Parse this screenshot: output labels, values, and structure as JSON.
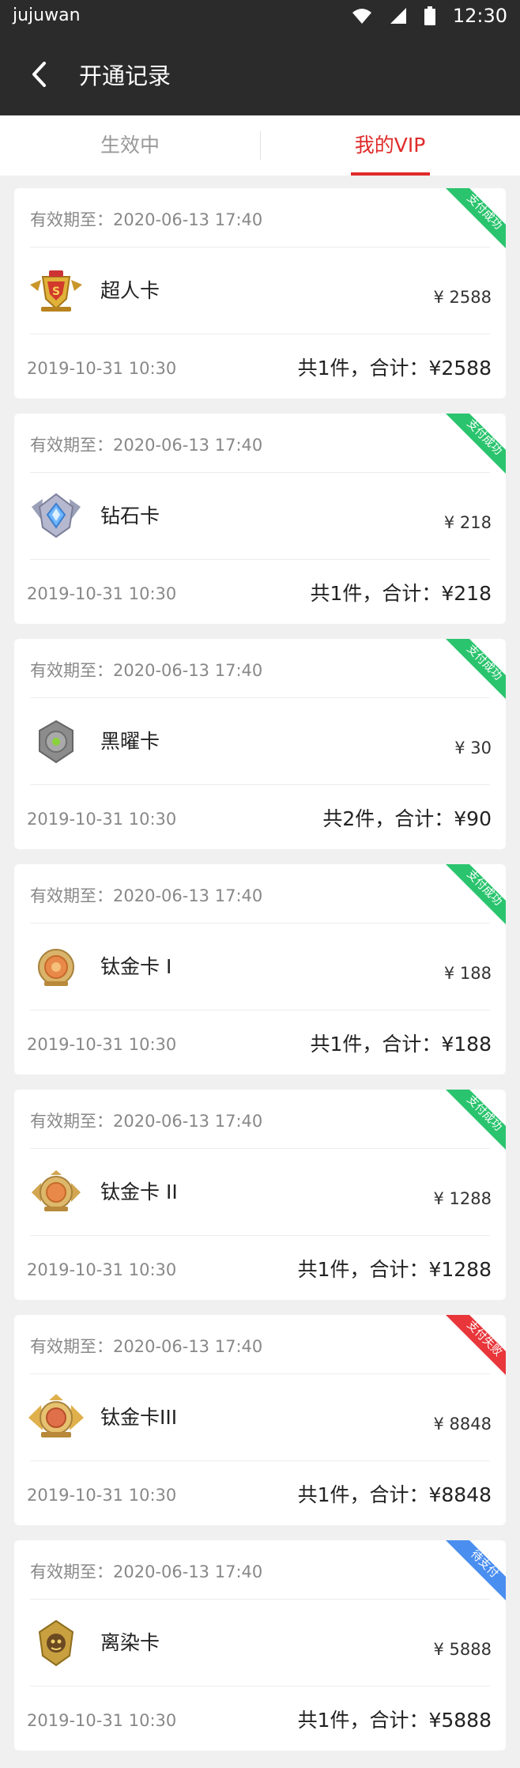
{
  "status_bar": {
    "carrier": "jujuwan",
    "time": "12:30"
  },
  "app_bar": {
    "title": "开通记录"
  },
  "tabs": [
    {
      "label": "生效中",
      "active": false
    },
    {
      "label": "我的VIP",
      "active": true
    }
  ],
  "colors": {
    "accent": "#e02b2b",
    "status_success": "#2bc46e",
    "status_failed": "#e8363a",
    "status_pending": "#4a8ef0"
  },
  "orders": [
    {
      "expiry": "有效期至：2020-06-13 17:40",
      "status": "支付成功",
      "status_type": "success",
      "icon": "superman-badge-icon",
      "name": "超人卡",
      "price": "¥ 2588",
      "date": "2019-10-31 10:30",
      "total": "共1件，合计：¥2588"
    },
    {
      "expiry": "有效期至：2020-06-13 17:40",
      "status": "支付成功",
      "status_type": "success",
      "icon": "diamond-badge-icon",
      "name": "钻石卡",
      "price": "¥ 218",
      "date": "2019-10-31 10:30",
      "total": "共1件，合计：¥218"
    },
    {
      "expiry": "有效期至：2020-06-13 17:40",
      "status": "支付成功",
      "status_type": "success",
      "icon": "obsidian-badge-icon",
      "name": "黑曜卡",
      "price": "¥ 30",
      "date": "2019-10-31 10:30",
      "total": "共2件，合计：¥90"
    },
    {
      "expiry": "有效期至：2020-06-13 17:40",
      "status": "支付成功",
      "status_type": "success",
      "icon": "titanium-badge-1-icon",
      "name": "钛金卡 I",
      "price": "¥ 188",
      "date": "2019-10-31 10:30",
      "total": "共1件，合计：¥188"
    },
    {
      "expiry": "有效期至：2020-06-13 17:40",
      "status": "支付成功",
      "status_type": "success",
      "icon": "titanium-badge-2-icon",
      "name": "钛金卡 II",
      "price": "¥ 1288",
      "date": "2019-10-31 10:30",
      "total": "共1件，合计：¥1288"
    },
    {
      "expiry": "有效期至：2020-06-13 17:40",
      "status": "支付失败",
      "status_type": "failed",
      "icon": "titanium-badge-3-icon",
      "name": "钛金卡III",
      "price": "¥ 8848",
      "date": "2019-10-31 10:30",
      "total": "共1件，合计：¥8848"
    },
    {
      "expiry": "有效期至：2020-06-13 17:40",
      "status": "待支付",
      "status_type": "pending",
      "icon": "lirang-badge-icon",
      "name": "离染卡",
      "price": "¥ 5888",
      "date": "2019-10-31 10:30",
      "total": "共1件，合计：¥5888"
    }
  ]
}
